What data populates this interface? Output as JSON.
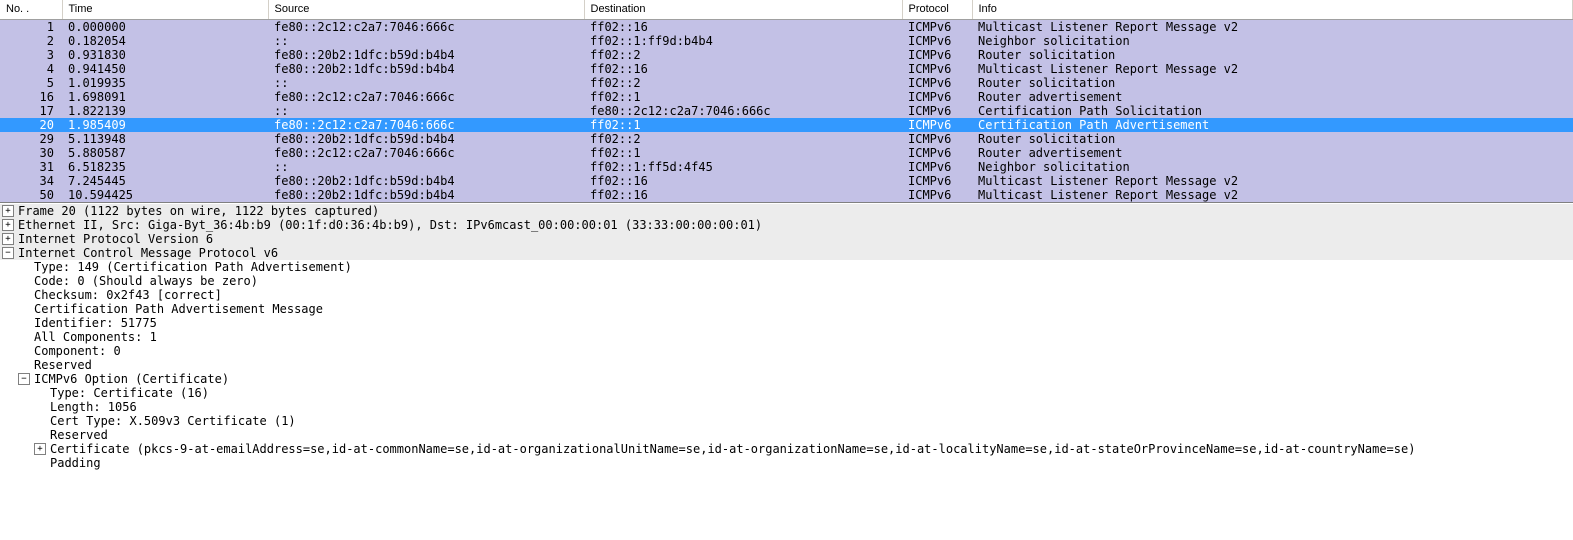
{
  "columns": {
    "no": "No. .",
    "time": "Time",
    "src": "Source",
    "dst": "Destination",
    "proto": "Protocol",
    "info": "Info"
  },
  "packets": [
    {
      "no": "1",
      "time": "0.000000",
      "src": "fe80::2c12:c2a7:7046:666c",
      "dst": "ff02::16",
      "proto": "ICMPv6",
      "info": "Multicast Listener Report Message v2",
      "sel": false
    },
    {
      "no": "2",
      "time": "0.182054",
      "src": "::",
      "dst": "ff02::1:ff9d:b4b4",
      "proto": "ICMPv6",
      "info": "Neighbor solicitation",
      "sel": false
    },
    {
      "no": "3",
      "time": "0.931830",
      "src": "fe80::20b2:1dfc:b59d:b4b4",
      "dst": "ff02::2",
      "proto": "ICMPv6",
      "info": "Router solicitation",
      "sel": false
    },
    {
      "no": "4",
      "time": "0.941450",
      "src": "fe80::20b2:1dfc:b59d:b4b4",
      "dst": "ff02::16",
      "proto": "ICMPv6",
      "info": "Multicast Listener Report Message v2",
      "sel": false
    },
    {
      "no": "5",
      "time": "1.019935",
      "src": "::",
      "dst": "ff02::2",
      "proto": "ICMPv6",
      "info": "Router solicitation",
      "sel": false
    },
    {
      "no": "16",
      "time": "1.698091",
      "src": "fe80::2c12:c2a7:7046:666c",
      "dst": "ff02::1",
      "proto": "ICMPv6",
      "info": "Router advertisement",
      "sel": false
    },
    {
      "no": "17",
      "time": "1.822139",
      "src": "::",
      "dst": "fe80::2c12:c2a7:7046:666c",
      "proto": "ICMPv6",
      "info": "Certification Path Solicitation",
      "sel": false
    },
    {
      "no": "20",
      "time": "1.985409",
      "src": "fe80::2c12:c2a7:7046:666c",
      "dst": "ff02::1",
      "proto": "ICMPv6",
      "info": "Certification Path Advertisement",
      "sel": true
    },
    {
      "no": "29",
      "time": "5.113948",
      "src": "fe80::20b2:1dfc:b59d:b4b4",
      "dst": "ff02::2",
      "proto": "ICMPv6",
      "info": "Router solicitation",
      "sel": false
    },
    {
      "no": "30",
      "time": "5.880587",
      "src": "fe80::2c12:c2a7:7046:666c",
      "dst": "ff02::1",
      "proto": "ICMPv6",
      "info": "Router advertisement",
      "sel": false
    },
    {
      "no": "31",
      "time": "6.518235",
      "src": "::",
      "dst": "ff02::1:ff5d:4f45",
      "proto": "ICMPv6",
      "info": "Neighbor solicitation",
      "sel": false
    },
    {
      "no": "34",
      "time": "7.245445",
      "src": "fe80::20b2:1dfc:b59d:b4b4",
      "dst": "ff02::16",
      "proto": "ICMPv6",
      "info": "Multicast Listener Report Message v2",
      "sel": false
    },
    {
      "no": "50",
      "time": "10.594425",
      "src": "fe80::20b2:1dfc:b59d:b4b4",
      "dst": "ff02::16",
      "proto": "ICMPv6",
      "info": "Multicast Listener Report Message v2",
      "sel": false
    }
  ],
  "detail": {
    "frame": "Frame 20 (1122 bytes on wire, 1122 bytes captured)",
    "eth": "Ethernet II, Src: Giga-Byt_36:4b:b9 (00:1f:d0:36:4b:b9), Dst: IPv6mcast_00:00:00:01 (33:33:00:00:00:01)",
    "ipv6": "Internet Protocol Version 6",
    "icmpv6": "Internet Control Message Protocol v6",
    "icmp_type": "Type: 149 (Certification Path Advertisement)",
    "icmp_code": "Code: 0 (Should always be zero)",
    "icmp_chk": "Checksum: 0x2f43 [correct]",
    "icmp_msg": "Certification Path Advertisement Message",
    "icmp_id": "Identifier: 51775",
    "icmp_allcomp": "All Components: 1",
    "icmp_comp": "Component: 0",
    "icmp_res": "Reserved",
    "opt_header": "ICMPv6 Option (Certificate)",
    "opt_type": "Type: Certificate (16)",
    "opt_len": "Length: 1056",
    "opt_ctype": "Cert Type: X.509v3 Certificate (1)",
    "opt_res": "Reserved",
    "opt_cert": "Certificate (pkcs-9-at-emailAddress=se,id-at-commonName=se,id-at-organizationalUnitName=se,id-at-organizationName=se,id-at-localityName=se,id-at-stateOrProvinceName=se,id-at-countryName=se)",
    "opt_pad": "Padding"
  },
  "expanders": {
    "plus": "+",
    "minus": "−"
  }
}
